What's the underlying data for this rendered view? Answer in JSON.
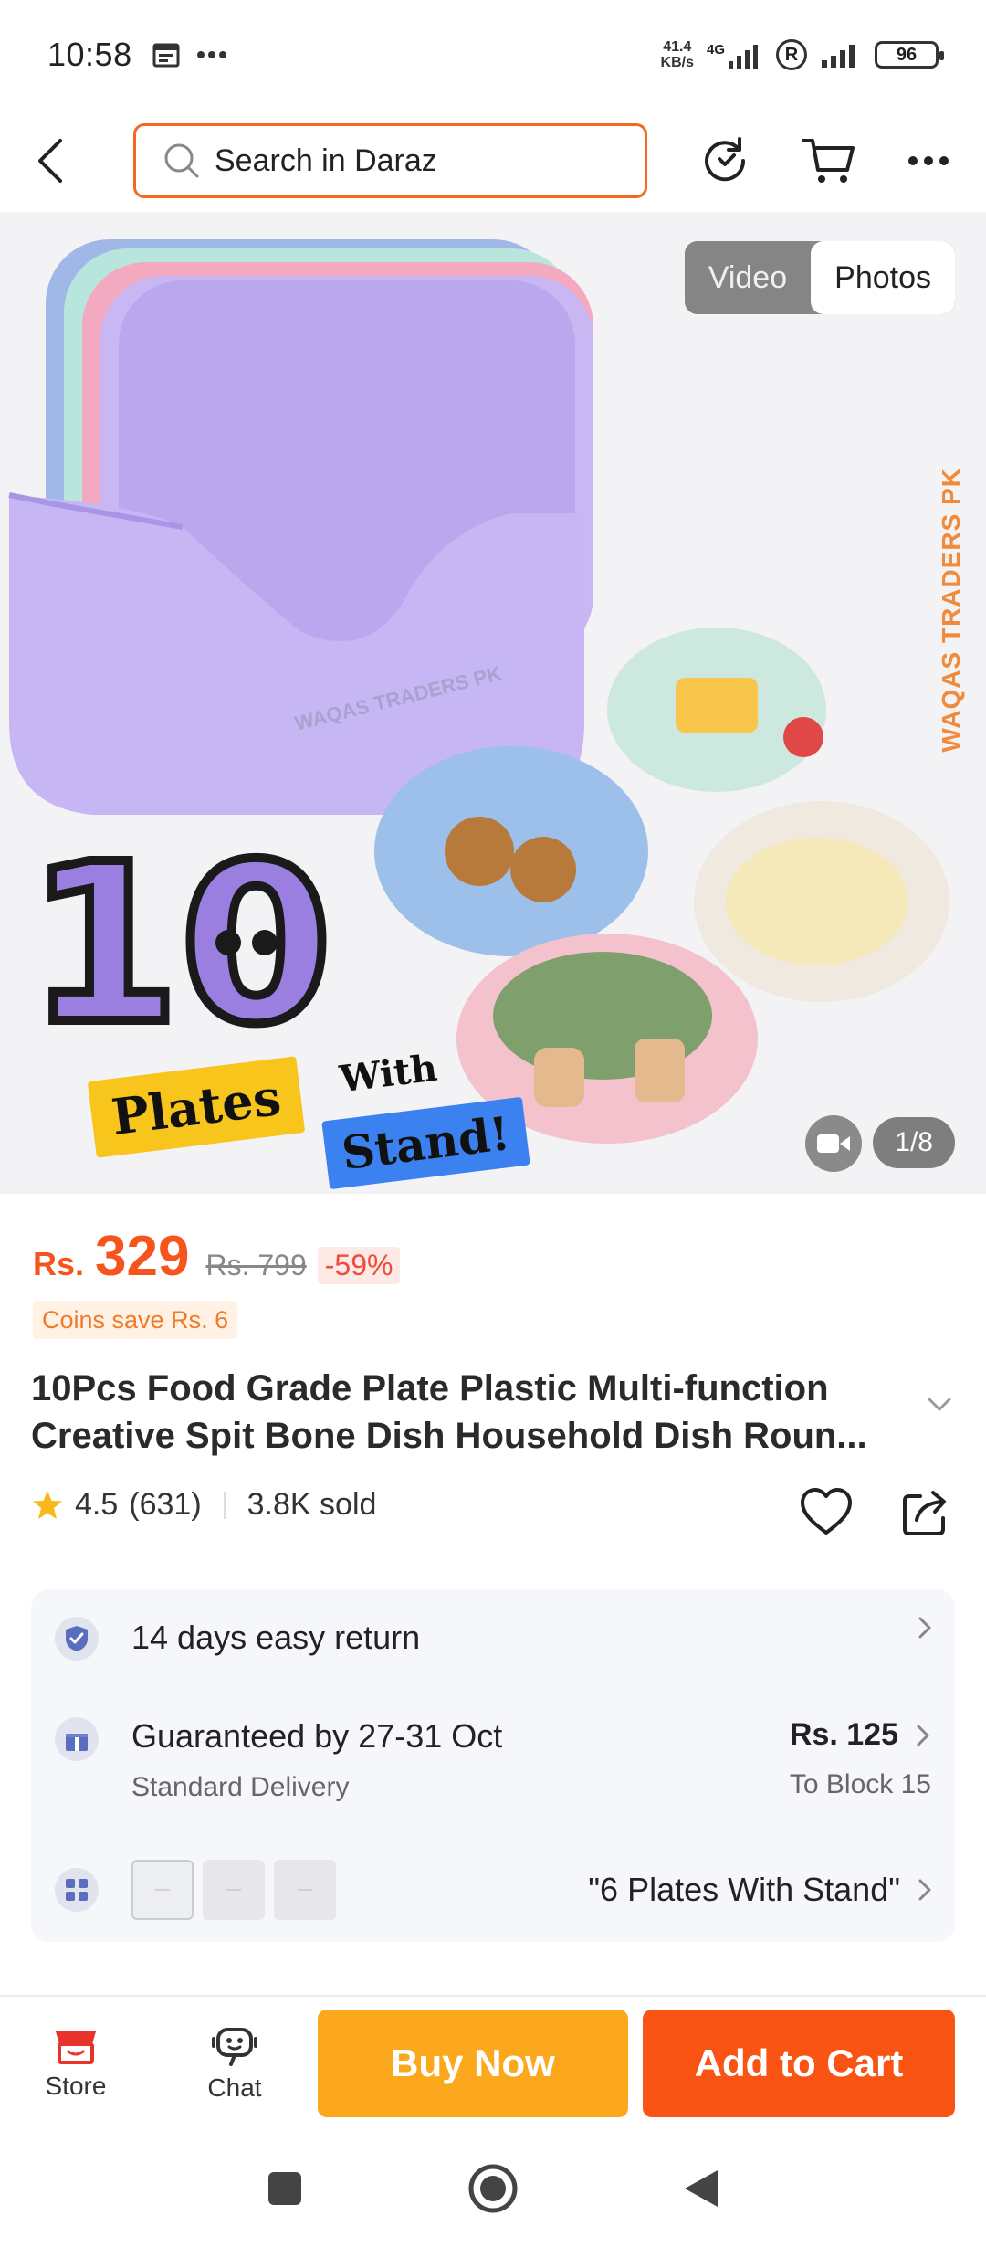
{
  "status_bar": {
    "time": "10:58",
    "net_speed_value": "41.4",
    "net_speed_unit": "KB/s",
    "net_type": "4G",
    "battery": "96"
  },
  "header": {
    "search_placeholder": "Search in Daraz"
  },
  "media": {
    "tab_video": "Video",
    "tab_photos": "Photos",
    "counter": "1/8",
    "watermark": "WAQAS TRADERS PK",
    "badge_number": "10",
    "badge_plates": "Plates",
    "badge_with": "With",
    "badge_stand": "Stand!"
  },
  "price": {
    "currency": "Rs.",
    "value": "329",
    "original": "Rs. 799",
    "discount": "-59%",
    "coins": "Coins save Rs. 6"
  },
  "product": {
    "title": "10Pcs Food Grade Plate Plastic Multi-function Creative Spit Bone Dish Household Dish Roun...",
    "rating": "4.5",
    "reviews": "(631)",
    "sold": "3.8K sold"
  },
  "services": {
    "returns": "14 days easy return",
    "delivery_title": "Guaranteed by 27-31 Oct",
    "delivery_type": "Standard Delivery",
    "delivery_price": "Rs. 125",
    "delivery_destination": "To Block 15",
    "variant_selected": "\"6 Plates With Stand\""
  },
  "bottom_bar": {
    "store": "Store",
    "chat": "Chat",
    "buy_now": "Buy Now",
    "add_to_cart": "Add to Cart"
  },
  "colors": {
    "accent_orange": "#f26a21",
    "price": "#f5551c",
    "buy_now": "#fca81c",
    "add_to_cart": "#fa5414"
  }
}
